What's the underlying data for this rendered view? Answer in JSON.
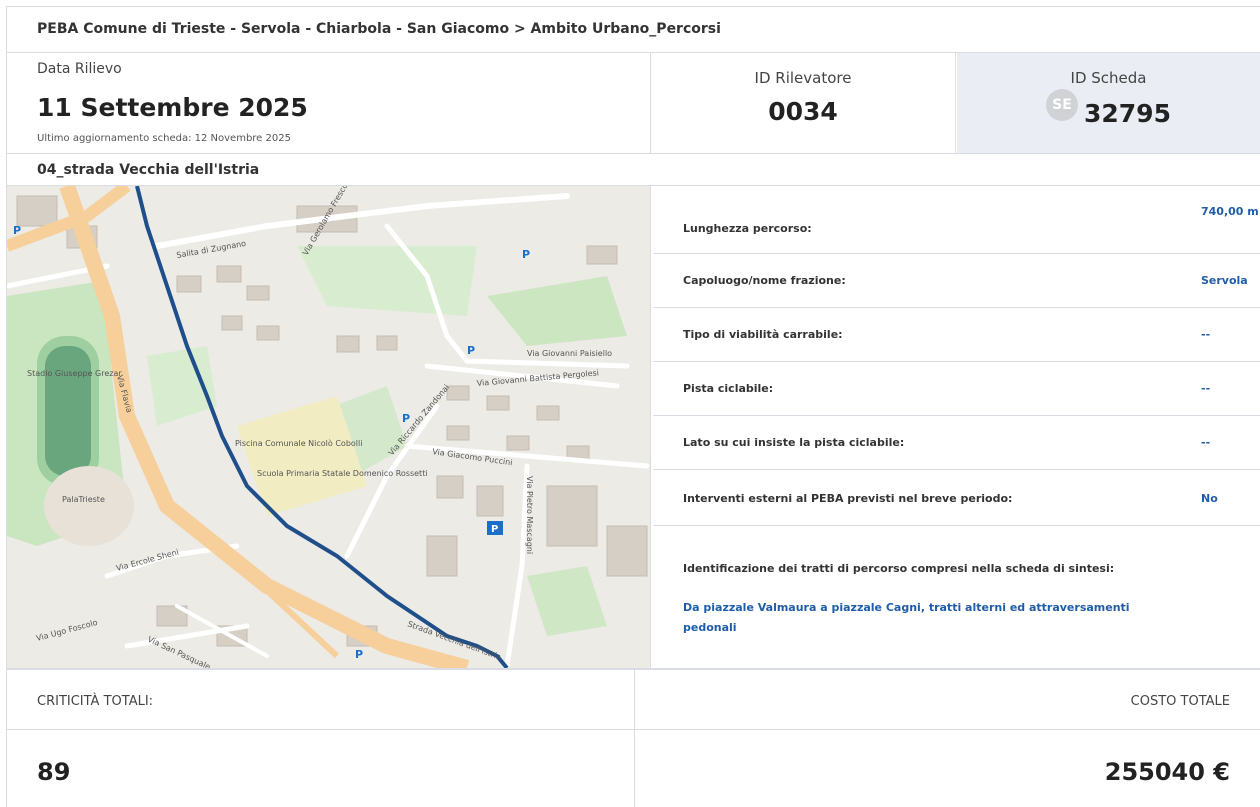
{
  "header": {
    "title": "PEBA Comune di Trieste - Servola - Chiarbola - San Giacomo > Ambito Urbano_Percorsi"
  },
  "meta": {
    "date_label": "Data Rilievo",
    "date_value": "11 Settembre 2025",
    "updated": "Ultimo aggiornamento scheda: 12 Novembre 2025",
    "rilevatore_label": "ID Rilevatore",
    "rilevatore_value": "0034",
    "scheda_label": "ID Scheda",
    "scheda_badge": "SE",
    "scheda_value": "32795"
  },
  "route": {
    "name": "04_strada Vecchia dell'Istria"
  },
  "map": {
    "streets": [
      "Salita di Zugnano",
      "Via Giovanni Paisiello",
      "Via Gerolamo Frescobaldi",
      "Via Giovanni Battista Pergolesi",
      "Via Riccardo Zandonai",
      "Via Giacomo Puccini",
      "Via Pietro Mascagni",
      "Via Ercole Sheni",
      "Via Flavia",
      "Via Ugo Foscolo",
      "Via San Pasquale",
      "Strada Vecchia dell'Istria"
    ],
    "places": [
      "Stadio Giuseppe Grezar",
      "PalaTrieste",
      "Piscina Comunale Nicolò Cobolli",
      "Scuola Primaria Statale Domenico Rossetti"
    ]
  },
  "details": [
    {
      "label": "Lunghezza percorso:",
      "value": "740,00 m"
    },
    {
      "label": "Capoluogo/nome frazione:",
      "value": "Servola"
    },
    {
      "label": "Tipo di viabilità carrabile:",
      "value": "--"
    },
    {
      "label": "Pista ciclabile:",
      "value": "--"
    },
    {
      "label": "Lato su cui insiste la pista ciclabile:",
      "value": "--"
    },
    {
      "label": "Interventi esterni al PEBA previsti nel breve periodo:",
      "value": "No"
    }
  ],
  "tratti": {
    "label": "Identificazione dei tratti di percorso compresi nella scheda di sintesi:",
    "value": "Da piazzale Valmaura a piazzale Cagni, tratti alterni ed attraversamenti pedonali"
  },
  "totals": {
    "criticita_label": "CRITICITÀ TOTALI:",
    "criticita_value": "89",
    "costo_label": "COSTO TOTALE",
    "costo_value": "255040 €"
  },
  "colors": {
    "link": "#1f5da8",
    "route": "#1e4f8a",
    "panel_bg": "#eaeef4"
  }
}
